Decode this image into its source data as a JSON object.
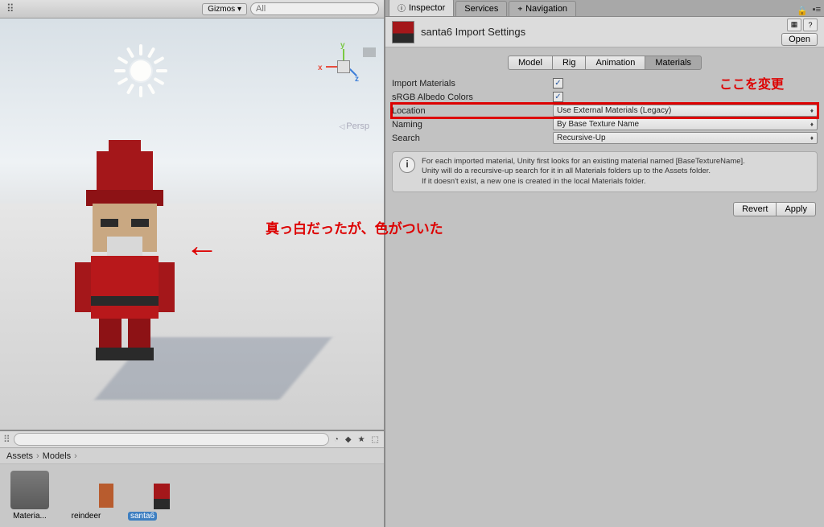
{
  "scene_toolbar": {
    "gizmos_label": "Gizmos",
    "search_placeholder": "All"
  },
  "persp_label": "Persp",
  "annotation_scene": "真っ白だったが、色がついた",
  "project": {
    "breadcrumb": [
      "Assets",
      "Models"
    ],
    "assets": [
      {
        "label": "Materia..."
      },
      {
        "label": "reindeer"
      },
      {
        "label": "santa6"
      }
    ]
  },
  "inspector": {
    "tabs": [
      {
        "label": "Inspector",
        "active": true
      },
      {
        "label": "Services",
        "active": false
      },
      {
        "label": "Navigation",
        "active": false
      }
    ],
    "title": "santa6 Import Settings",
    "open_label": "Open",
    "sub_tabs": [
      {
        "label": "Model"
      },
      {
        "label": "Rig"
      },
      {
        "label": "Animation"
      },
      {
        "label": "Materials",
        "active": true
      }
    ],
    "annotation_change": "ここを変更",
    "props": {
      "import_materials": {
        "label": "Import Materials",
        "checked": true
      },
      "srgb": {
        "label": "sRGB Albedo Colors",
        "checked": true
      },
      "location": {
        "label": "Location",
        "value": "Use External Materials (Legacy)"
      },
      "naming": {
        "label": "Naming",
        "value": "By Base Texture Name"
      },
      "search": {
        "label": "Search",
        "value": "Recursive-Up"
      }
    },
    "info_text": "For each imported material, Unity first looks for an existing material named [BaseTextureName].\nUnity will do a recursive-up search for it in all Materials folders up to the Assets folder.\nIf it doesn't exist, a new one is created in the local Materials folder.",
    "revert_label": "Revert",
    "apply_label": "Apply"
  }
}
